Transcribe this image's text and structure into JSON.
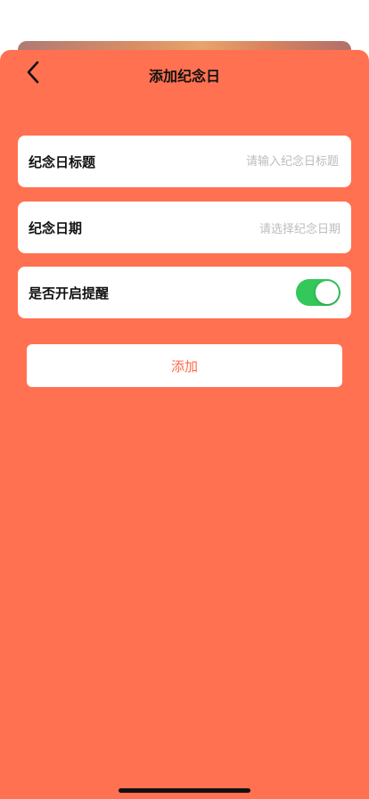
{
  "colors": {
    "sheet_background": "#ff7150",
    "toggle_on": "#34c759",
    "add_button_text": "#ff6a48"
  },
  "header": {
    "back_icon": "chevron-left-icon",
    "title": "添加纪念日"
  },
  "form": {
    "title_field": {
      "label": "纪念日标题",
      "placeholder": "请输入纪念日标题",
      "value": ""
    },
    "date_field": {
      "label": "纪念日期",
      "placeholder": "请选择纪念日期"
    },
    "reminder": {
      "label": "是否开启提醒",
      "enabled": true
    }
  },
  "actions": {
    "add_label": "添加"
  }
}
